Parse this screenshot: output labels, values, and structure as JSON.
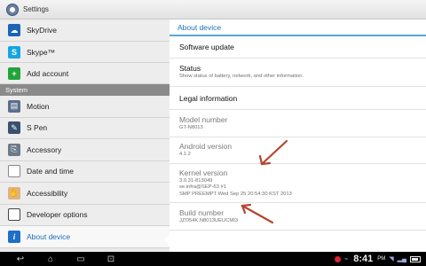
{
  "titlebar": {
    "title": "Settings"
  },
  "sidebar": {
    "items_top": [
      {
        "label": "SkyDrive",
        "icon": "skydrive-icon",
        "glyph": "☁"
      },
      {
        "label": "Skype™",
        "icon": "skype-icon",
        "glyph": "S"
      },
      {
        "label": "Add account",
        "icon": "add-account-icon",
        "glyph": "+"
      }
    ],
    "section": "System",
    "items_system": [
      {
        "label": "Motion",
        "icon": "motion-icon",
        "glyph": "▤"
      },
      {
        "label": "S Pen",
        "icon": "s-pen-icon",
        "glyph": "✎"
      },
      {
        "label": "Accessory",
        "icon": "accessory-icon",
        "glyph": "⎘"
      },
      {
        "label": "Date and time",
        "icon": "clock-icon",
        "glyph": "◔"
      },
      {
        "label": "Accessibility",
        "icon": "hand-icon",
        "glyph": "✋"
      },
      {
        "label": "Developer options",
        "icon": "code-braces-icon",
        "glyph": "{}"
      },
      {
        "label": "About device",
        "icon": "info-icon",
        "glyph": "i"
      }
    ]
  },
  "detail": {
    "header": "About device",
    "software_update": "Software update",
    "status": {
      "title": "Status",
      "sub": "Show status of battery, network, and other information."
    },
    "legal": "Legal information",
    "model": {
      "title": "Model number",
      "value": "GT-N8013"
    },
    "android": {
      "title": "Android version",
      "value": "4.1.2"
    },
    "kernel": {
      "title": "Kernel version",
      "line1": "3.0.31-813049",
      "line2": "se.infra@SEP-63 #1",
      "line3": "SMP PREEMPT Wed Sep 25 20:54:30 KST 2013"
    },
    "build": {
      "title": "Build number",
      "value": "JZO54K.N8013UEUCMI3"
    }
  },
  "sysbar": {
    "back_glyph": "↩",
    "home_glyph": "⌂",
    "recent_glyph": "▭",
    "screenshot_glyph": "⊡",
    "time": "8:41",
    "ampm": "PM",
    "status_icons": [
      "usb-icon",
      "wifi-icon",
      "signal-icon"
    ]
  },
  "colors": {
    "accent": "#1e6fb8",
    "annotation_arrow": "#b5452f"
  }
}
